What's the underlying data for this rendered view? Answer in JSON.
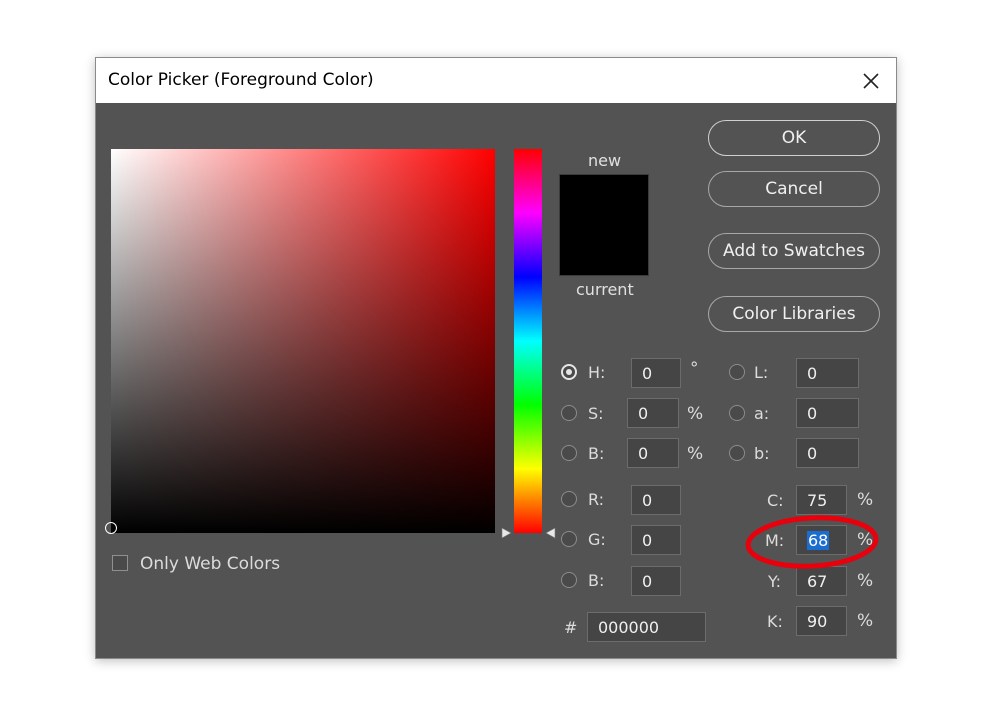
{
  "window": {
    "title": "Color Picker (Foreground Color)",
    "close_icon": "close-icon"
  },
  "preview": {
    "new_label": "new",
    "current_label": "current",
    "new_color": "#000000",
    "current_color": "#000000"
  },
  "buttons": {
    "ok": "OK",
    "cancel": "Cancel",
    "add_to_swatches": "Add to Swatches",
    "color_libraries": "Color Libraries"
  },
  "hsb": {
    "h_label": "H:",
    "h_value": "0",
    "h_unit": "°",
    "s_label": "S:",
    "s_value": "0",
    "s_unit": "%",
    "b_label": "B:",
    "b_value": "0",
    "b_unit": "%"
  },
  "rgb": {
    "r_label": "R:",
    "r_value": "0",
    "g_label": "G:",
    "g_value": "0",
    "b_label": "B:",
    "b_value": "0"
  },
  "lab": {
    "l_label": "L:",
    "l_value": "0",
    "a_label": "a:",
    "a_value": "0",
    "b_label": "b:",
    "b_value": "0"
  },
  "cmyk": {
    "c_label": "C:",
    "c_value": "75",
    "c_unit": "%",
    "m_label": "M:",
    "m_value": "68",
    "m_unit": "%",
    "y_label": "Y:",
    "y_value": "67",
    "y_unit": "%",
    "k_label": "K:",
    "k_value": "90",
    "k_unit": "%"
  },
  "hex": {
    "label": "#",
    "value": "000000"
  },
  "web_colors": {
    "label": "Only Web Colors",
    "checked": false
  },
  "colors": {
    "dialog_bg": "#535353",
    "selection": "#1c6dd0",
    "annotation": "#e8000d"
  }
}
